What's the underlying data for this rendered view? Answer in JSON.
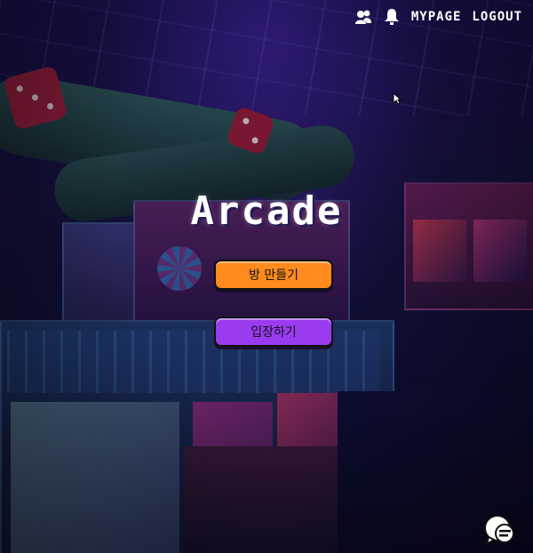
{
  "page": {
    "title": "Arcade"
  },
  "nav": {
    "icons": [
      "friends-icon",
      "bell-icon"
    ],
    "mypage_label": "MYPAGE",
    "logout_label": "LOGOUT"
  },
  "main": {
    "title": "Arcade",
    "create_room_label": "방 만들기",
    "enter_label": "입장하기"
  },
  "floating": {
    "chat_icon": "chat-bubble-icon"
  },
  "colors": {
    "create_button": "#ff8a1d",
    "enter_button": "#9b3bf0",
    "text": "#ffffff",
    "background": "#14123a"
  }
}
